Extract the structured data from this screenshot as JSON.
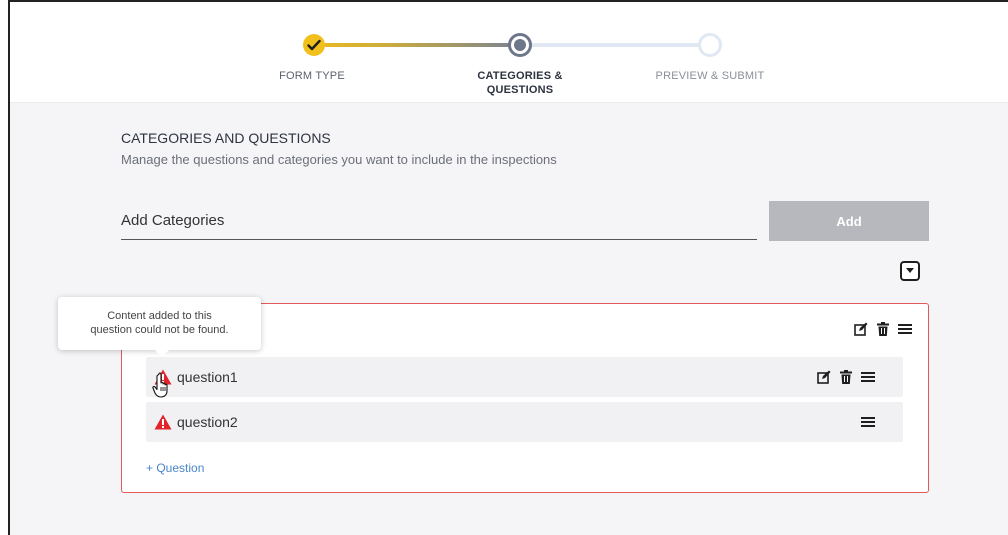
{
  "stepper": {
    "steps": [
      {
        "label": "FORM TYPE",
        "state": "completed"
      },
      {
        "label": "CATEGORIES &\nQUESTIONS",
        "state": "active"
      },
      {
        "label": "PREVIEW & SUBMIT",
        "state": "pending"
      }
    ]
  },
  "section": {
    "title": "CATEGORIES AND QUESTIONS",
    "subtitle": "Manage the questions and categories you want to include in the inspections"
  },
  "category_input": {
    "placeholder": "Add Categories",
    "value": ""
  },
  "add_button": {
    "label": "Add"
  },
  "tooltip": {
    "text": "Content added to this question could not be found."
  },
  "category": {
    "questions": [
      {
        "label": "question1",
        "warning": true
      },
      {
        "label": "question2",
        "warning": true
      }
    ],
    "add_question_label": "+ Question"
  },
  "colors": {
    "accent_yellow": "#f2c01d",
    "active_step": "#6e7789",
    "error_border": "#e05a5a",
    "warning_red": "#e2232b",
    "link_blue": "#4a86c8",
    "disabled_button": "#b7b8bd"
  },
  "icons": [
    "check-icon",
    "edit-icon",
    "trash-icon",
    "drag-handle-icon",
    "warning-icon",
    "collapse-icon",
    "hand-cursor-icon"
  ]
}
